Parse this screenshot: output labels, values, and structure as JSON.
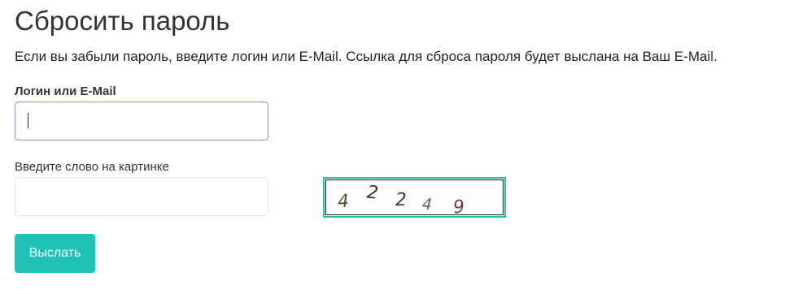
{
  "page": {
    "title": "Сбросить пароль",
    "description": "Если вы забыли пароль, введите логин или E-Mail. Ссылка для сброса пароля будет выслана на Ваш E-Mail."
  },
  "login_field": {
    "label": "Логин или E-Mail",
    "value": ""
  },
  "captcha_field": {
    "label": "Введите слово на картинке",
    "value": ""
  },
  "captcha": {
    "text": "42249",
    "characters": [
      "4",
      "2",
      "2",
      "4",
      "9"
    ],
    "border_color": "#1fc2b4"
  },
  "submit_button": {
    "label": "Выслать",
    "color": "#1fc2b4"
  },
  "colors": {
    "accent": "#1fc2b4",
    "focus_border": "#a77fd0",
    "text": "#333333"
  }
}
